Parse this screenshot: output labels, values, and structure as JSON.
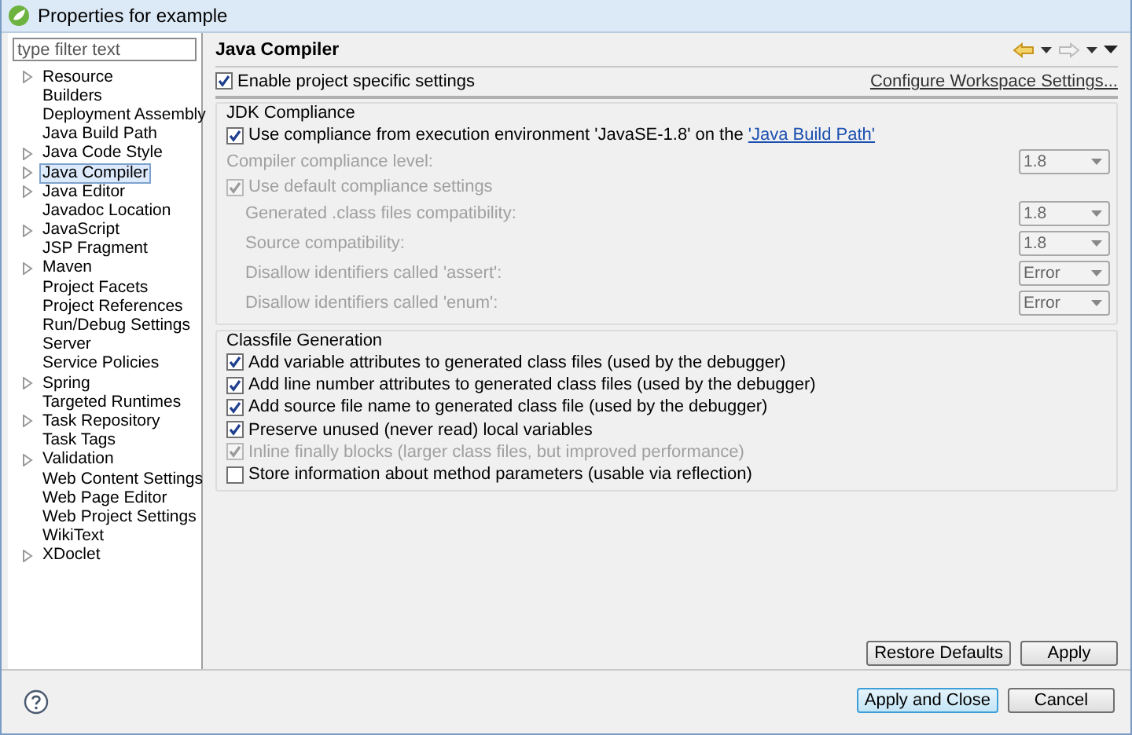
{
  "window": {
    "title": "Properties for example"
  },
  "sidebar": {
    "filter": {
      "placeholder": "type filter text"
    },
    "items": [
      {
        "label": "Resource",
        "expandable": true,
        "selected": false
      },
      {
        "label": "Builders",
        "expandable": false,
        "selected": false
      },
      {
        "label": "Deployment Assembly",
        "expandable": false,
        "selected": false
      },
      {
        "label": "Java Build Path",
        "expandable": false,
        "selected": false
      },
      {
        "label": "Java Code Style",
        "expandable": true,
        "selected": false
      },
      {
        "label": "Java Compiler",
        "expandable": true,
        "selected": true
      },
      {
        "label": "Java Editor",
        "expandable": true,
        "selected": false
      },
      {
        "label": "Javadoc Location",
        "expandable": false,
        "selected": false
      },
      {
        "label": "JavaScript",
        "expandable": true,
        "selected": false
      },
      {
        "label": "JSP Fragment",
        "expandable": false,
        "selected": false
      },
      {
        "label": "Maven",
        "expandable": true,
        "selected": false
      },
      {
        "label": "Project Facets",
        "expandable": false,
        "selected": false
      },
      {
        "label": "Project References",
        "expandable": false,
        "selected": false
      },
      {
        "label": "Run/Debug Settings",
        "expandable": false,
        "selected": false
      },
      {
        "label": "Server",
        "expandable": false,
        "selected": false
      },
      {
        "label": "Service Policies",
        "expandable": false,
        "selected": false
      },
      {
        "label": "Spring",
        "expandable": true,
        "selected": false
      },
      {
        "label": "Targeted Runtimes",
        "expandable": false,
        "selected": false
      },
      {
        "label": "Task Repository",
        "expandable": true,
        "selected": false
      },
      {
        "label": "Task Tags",
        "expandable": false,
        "selected": false
      },
      {
        "label": "Validation",
        "expandable": true,
        "selected": false
      },
      {
        "label": "Web Content Settings",
        "expandable": false,
        "selected": false
      },
      {
        "label": "Web Page Editor",
        "expandable": false,
        "selected": false
      },
      {
        "label": "Web Project Settings",
        "expandable": false,
        "selected": false
      },
      {
        "label": "WikiText",
        "expandable": false,
        "selected": false
      },
      {
        "label": "XDoclet",
        "expandable": true,
        "selected": false
      }
    ]
  },
  "page": {
    "title": "Java Compiler",
    "enable": {
      "label": "Enable project specific settings",
      "checked": true
    },
    "configure_link": "Configure Workspace Settings...",
    "jdk": {
      "title": "JDK Compliance",
      "use_ee": {
        "label": "Use compliance from execution environment 'JavaSE-1.8' on the ",
        "link": "'Java Build Path'",
        "checked": true
      },
      "compliance_level": {
        "label": "Compiler compliance level:",
        "value": "1.8",
        "disabled": true
      },
      "use_default": {
        "label": "Use default compliance settings",
        "checked": true,
        "disabled": true
      },
      "settings": [
        {
          "label": "Generated .class files compatibility:",
          "value": "1.8",
          "disabled": true
        },
        {
          "label": "Source compatibility:",
          "value": "1.8",
          "disabled": true
        },
        {
          "label": "Disallow identifiers called 'assert':",
          "value": "Error",
          "disabled": true
        },
        {
          "label": "Disallow identifiers called 'enum':",
          "value": "Error",
          "disabled": true
        }
      ]
    },
    "classfile": {
      "title": "Classfile Generation",
      "options": [
        {
          "label": "Add variable attributes to generated class files (used by the debugger)",
          "checked": true,
          "disabled": false
        },
        {
          "label": "Add line number attributes to generated class files (used by the debugger)",
          "checked": true,
          "disabled": false
        },
        {
          "label": "Add source file name to generated class file (used by the debugger)",
          "checked": true,
          "disabled": false
        },
        {
          "label": "Preserve unused (never read) local variables",
          "checked": true,
          "disabled": false
        },
        {
          "label": "Inline finally blocks (larger class files, but improved performance)",
          "checked": true,
          "disabled": true
        },
        {
          "label": "Store information about method parameters (usable via reflection)",
          "checked": false,
          "disabled": false
        }
      ]
    },
    "page_buttons": [
      "Restore Defaults",
      "Apply"
    ]
  },
  "dialog_buttons": [
    {
      "label": "Apply and Close",
      "default": true
    },
    {
      "label": "Cancel",
      "default": false
    }
  ]
}
